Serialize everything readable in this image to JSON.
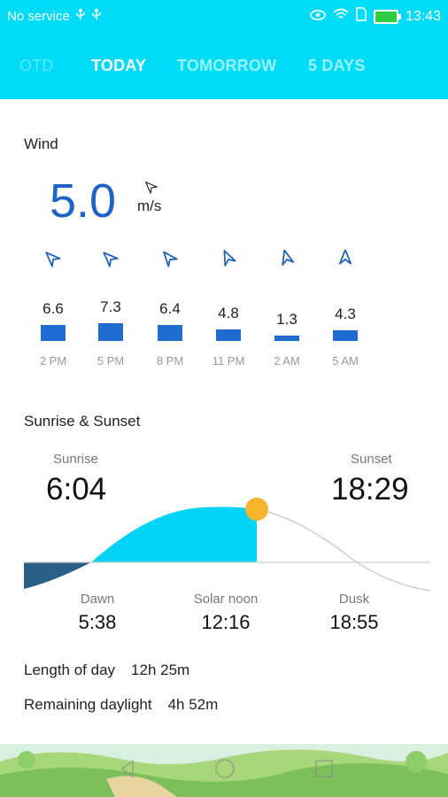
{
  "status": {
    "left_text": "No service",
    "left_icons": [
      "usb-icon",
      "usb-icon"
    ],
    "right_icons": [
      "eye-icon",
      "wifi-icon",
      "sim-icon",
      "battery-icon"
    ],
    "time": "13:43"
  },
  "tabs": [
    "OTD",
    "TODAY",
    "TOMORROW",
    "5 DAYS"
  ],
  "wind": {
    "title": "Wind",
    "value": "5.0",
    "unit": "m/s",
    "forecast": [
      {
        "value": "6.6",
        "time": "2 PM",
        "speed": 6.6,
        "arrow_angle": -40
      },
      {
        "value": "7.3",
        "time": "5 PM",
        "speed": 7.3,
        "arrow_angle": -40
      },
      {
        "value": "6.4",
        "time": "8 PM",
        "speed": 6.4,
        "arrow_angle": -35
      },
      {
        "value": "4.8",
        "time": "11 PM",
        "speed": 4.8,
        "arrow_angle": -20
      },
      {
        "value": "1.3",
        "time": "2 AM",
        "speed": 1.3,
        "arrow_angle": -10
      },
      {
        "value": "4.3",
        "time": "5 AM",
        "speed": 4.3,
        "arrow_angle": 5
      }
    ]
  },
  "sun": {
    "title": "Sunrise & Sunset",
    "sunrise_label": "Sunrise",
    "sunrise_time": "6:04",
    "sunset_label": "Sunset",
    "sunset_time": "18:29",
    "dawn_label": "Dawn",
    "dawn_time": "5:38",
    "noon_label": "Solar noon",
    "noon_time": "12:16",
    "dusk_label": "Dusk",
    "dusk_time": "18:55",
    "length_label": "Length of day",
    "length_value": "12h 25m",
    "remaining_label": "Remaining daylight",
    "remaining_value": "4h 52m"
  },
  "colors": {
    "header": "#00dcf8",
    "accent_blue": "#1e63c5",
    "bar_blue": "#1e6cd2",
    "day_fill": "#00d4f6",
    "night_fill": "#2c5f88",
    "sun": "#f7b52c"
  }
}
